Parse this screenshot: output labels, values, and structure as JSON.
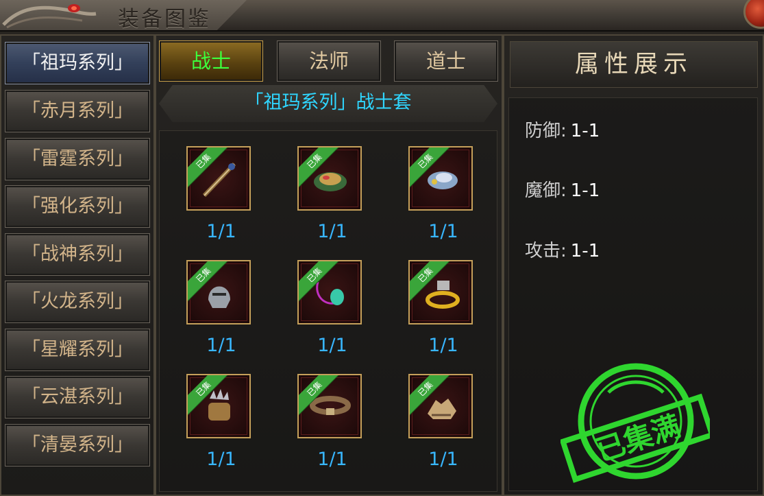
{
  "header": {
    "title": "装备图鉴"
  },
  "series": [
    {
      "label": "「祖玛系列」",
      "active": true
    },
    {
      "label": "「赤月系列」",
      "active": false
    },
    {
      "label": "「雷霆系列」",
      "active": false
    },
    {
      "label": "「强化系列」",
      "active": false
    },
    {
      "label": "「战神系列」",
      "active": false
    },
    {
      "label": "「火龙系列」",
      "active": false
    },
    {
      "label": "「星耀系列」",
      "active": false
    },
    {
      "label": "「云湛系列」",
      "active": false
    },
    {
      "label": "「清晏系列」",
      "active": false
    }
  ],
  "class_tabs": [
    {
      "label": "战士",
      "active": true
    },
    {
      "label": "法师",
      "active": false
    },
    {
      "label": "道士",
      "active": false
    }
  ],
  "set_title": "「祖玛系列」战士套",
  "items": [
    {
      "icon": "staff-weapon-icon",
      "badge": "已集",
      "count": "1/1"
    },
    {
      "icon": "armor-icon",
      "badge": "已集",
      "count": "1/1"
    },
    {
      "icon": "armor-female-icon",
      "badge": "已集",
      "count": "1/1"
    },
    {
      "icon": "helmet-icon",
      "badge": "已集",
      "count": "1/1"
    },
    {
      "icon": "necklace-icon",
      "badge": "已集",
      "count": "1/1"
    },
    {
      "icon": "bracelet-icon",
      "badge": "已集",
      "count": "1/1"
    },
    {
      "icon": "ring-icon",
      "badge": "已集",
      "count": "1/1"
    },
    {
      "icon": "belt-icon",
      "badge": "已集",
      "count": "1/1"
    },
    {
      "icon": "boots-icon",
      "badge": "已集",
      "count": "1/1"
    }
  ],
  "attributes": {
    "title": "属性展示",
    "rows": [
      {
        "label": "防御:",
        "value": "1-1"
      },
      {
        "label": "魔御:",
        "value": "1-1"
      },
      {
        "label": "攻击:",
        "value": "1-1"
      }
    ]
  },
  "stamp": {
    "text": "已集满",
    "color": "#2fd62f"
  },
  "colors": {
    "accent_green": "#3cff3c",
    "count_blue": "#38b6ff",
    "set_title_cyan": "#2fd6ff",
    "ribbon_green": "#3aa53a"
  }
}
